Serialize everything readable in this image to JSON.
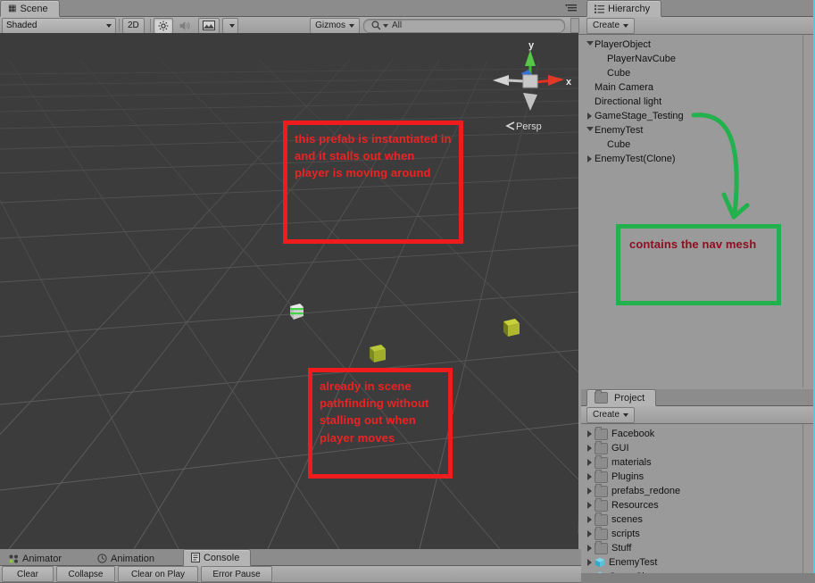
{
  "scene_panel": {
    "tab_label": "Scene",
    "tab_icon": "grid-icon",
    "shading_mode": "Shaded",
    "button_2d": "2D",
    "lighting_icon": "sun-icon",
    "audio_icon": "speaker-icon",
    "effects_icon": "image-icon",
    "gizmos_label": "Gizmos",
    "search_placeholder": "All",
    "search_value": "All",
    "search_icon": "search-icon",
    "gizmo": {
      "axis_x": "x",
      "axis_y": "y",
      "projection": "Persp",
      "color_x": "#e03020",
      "color_y": "#3cb832",
      "color_z": "#3870d0"
    },
    "background_color": "#3c3c3c"
  },
  "annotations": [
    {
      "id": "prefab-note",
      "text": "this prefab is instantiated in and it stalls out when player is moving around",
      "color": "#ee2222",
      "style": "red-box"
    },
    {
      "id": "scene-note",
      "text": "already in scene pathfinding without stalling out when player moves",
      "color": "#ee2222",
      "style": "red-box"
    },
    {
      "id": "navmesh-note",
      "text": "contains the nav mesh",
      "color": "#8b1020",
      "border_color": "#22b14c",
      "style": "green-box"
    }
  ],
  "hierarchy": {
    "tab_label": "Hierarchy",
    "tab_icon": "list-icon",
    "create_label": "Create",
    "items": [
      {
        "label": "PlayerObject",
        "depth": 0,
        "twisty": "open"
      },
      {
        "label": "PlayerNavCube",
        "depth": 1,
        "twisty": "none"
      },
      {
        "label": "Cube",
        "depth": 1,
        "twisty": "none"
      },
      {
        "label": "Main Camera",
        "depth": 0,
        "twisty": "none"
      },
      {
        "label": "Directional light",
        "depth": 0,
        "twisty": "none"
      },
      {
        "label": "GameStage_Testing",
        "depth": 0,
        "twisty": "closed"
      },
      {
        "label": "EnemyTest",
        "depth": 0,
        "twisty": "open"
      },
      {
        "label": "Cube",
        "depth": 1,
        "twisty": "none"
      },
      {
        "label": "EnemyTest(Clone)",
        "depth": 0,
        "twisty": "closed"
      }
    ]
  },
  "project": {
    "tab_label": "Project",
    "tab_icon": "folder-icon",
    "create_label": "Create",
    "items": [
      {
        "label": "Facebook",
        "type": "folder"
      },
      {
        "label": "GUI",
        "type": "folder"
      },
      {
        "label": "materials",
        "type": "folder"
      },
      {
        "label": "Plugins",
        "type": "folder"
      },
      {
        "label": "prefabs_redone",
        "type": "folder"
      },
      {
        "label": "Resources",
        "type": "folder"
      },
      {
        "label": "scenes",
        "type": "folder"
      },
      {
        "label": "scripts",
        "type": "folder"
      },
      {
        "label": "Stuff",
        "type": "folder"
      },
      {
        "label": "EnemyTest",
        "type": "prefab"
      },
      {
        "label": "GameShape",
        "type": "prefab"
      }
    ]
  },
  "bottom_dock": {
    "tabs": [
      {
        "label": "Animator",
        "icon": "animator-icon",
        "active": false
      },
      {
        "label": "Animation",
        "icon": "clock-icon",
        "active": false
      },
      {
        "label": "Console",
        "icon": "console-icon",
        "active": true
      }
    ],
    "console_toolbar": [
      "Clear",
      "Collapse",
      "Clear on Play",
      "Error Pause"
    ]
  }
}
